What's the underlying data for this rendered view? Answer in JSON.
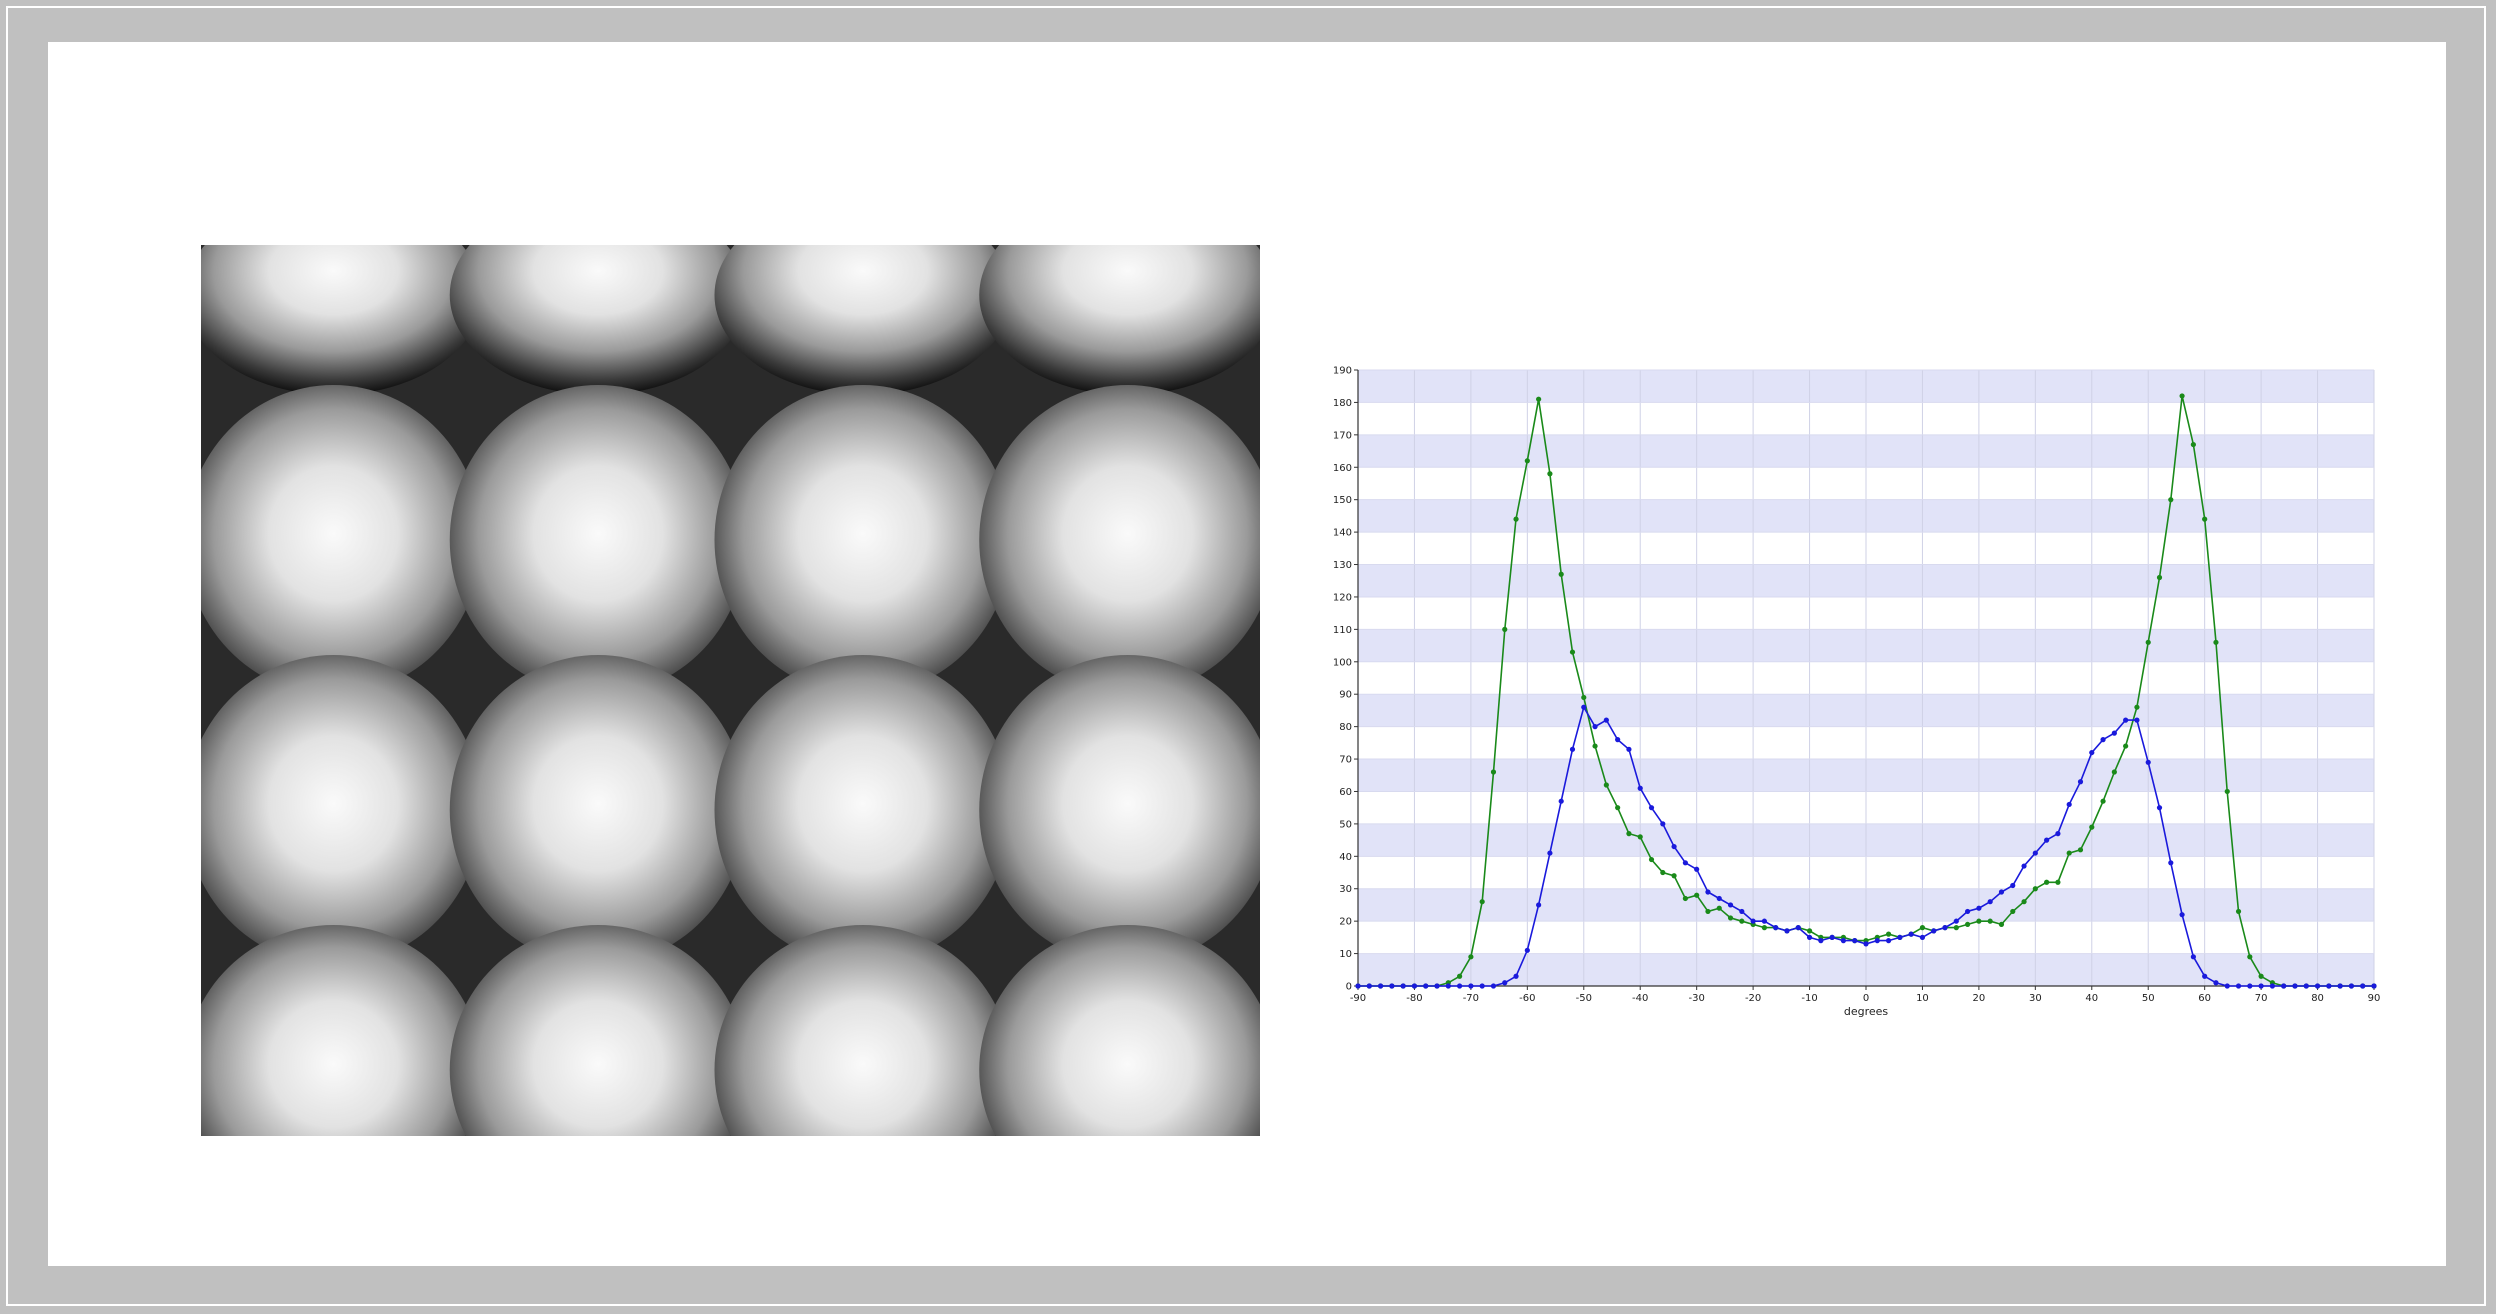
{
  "figure": {
    "image_alt_kind": "grayscale periodic intensity pattern"
  },
  "colors": {
    "background_border": "#c0c0c0",
    "canvas": "#ffffff",
    "band": "#e1e3f8",
    "series_green": "#1a8a1a",
    "series_blue": "#1a1adc",
    "axis": "#333333"
  },
  "chart_data": {
    "type": "line",
    "title": "",
    "xlabel": "degrees",
    "ylabel": "",
    "xlim": [
      -90,
      90
    ],
    "ylim": [
      0,
      190
    ],
    "x_ticks": [
      -90,
      -80,
      -70,
      -60,
      -50,
      -40,
      -30,
      -20,
      -10,
      0,
      10,
      20,
      30,
      40,
      50,
      60,
      70,
      80,
      90
    ],
    "y_ticks": [
      0,
      10,
      20,
      30,
      40,
      50,
      60,
      70,
      80,
      90,
      100,
      110,
      120,
      130,
      140,
      150,
      160,
      170,
      180,
      190
    ],
    "grid": "vertical lines and horizontal bands",
    "series": [
      {
        "color": "green",
        "points": [
          [
            -90,
            0
          ],
          [
            -88,
            0
          ],
          [
            -86,
            0
          ],
          [
            -84,
            0
          ],
          [
            -82,
            0
          ],
          [
            -80,
            0
          ],
          [
            -78,
            0
          ],
          [
            -76,
            0
          ],
          [
            -74,
            1
          ],
          [
            -72,
            3
          ],
          [
            -70,
            9
          ],
          [
            -68,
            26
          ],
          [
            -66,
            66
          ],
          [
            -64,
            110
          ],
          [
            -62,
            144
          ],
          [
            -60,
            162
          ],
          [
            -58,
            181
          ],
          [
            -56,
            158
          ],
          [
            -54,
            127
          ],
          [
            -52,
            103
          ],
          [
            -50,
            89
          ],
          [
            -48,
            74
          ],
          [
            -46,
            62
          ],
          [
            -44,
            55
          ],
          [
            -42,
            47
          ],
          [
            -40,
            46
          ],
          [
            -38,
            39
          ],
          [
            -36,
            35
          ],
          [
            -34,
            34
          ],
          [
            -32,
            27
          ],
          [
            -30,
            28
          ],
          [
            -28,
            23
          ],
          [
            -26,
            24
          ],
          [
            -24,
            21
          ],
          [
            -22,
            20
          ],
          [
            -20,
            19
          ],
          [
            -18,
            18
          ],
          [
            -16,
            18
          ],
          [
            -14,
            17
          ],
          [
            -12,
            18
          ],
          [
            -10,
            17
          ],
          [
            -8,
            15
          ],
          [
            -6,
            15
          ],
          [
            -4,
            15
          ],
          [
            -2,
            14
          ],
          [
            0,
            14
          ],
          [
            2,
            15
          ],
          [
            4,
            16
          ],
          [
            6,
            15
          ],
          [
            8,
            16
          ],
          [
            10,
            18
          ],
          [
            12,
            17
          ],
          [
            14,
            18
          ],
          [
            16,
            18
          ],
          [
            18,
            19
          ],
          [
            20,
            20
          ],
          [
            22,
            20
          ],
          [
            24,
            19
          ],
          [
            26,
            23
          ],
          [
            28,
            26
          ],
          [
            30,
            30
          ],
          [
            32,
            32
          ],
          [
            34,
            32
          ],
          [
            36,
            41
          ],
          [
            38,
            42
          ],
          [
            40,
            49
          ],
          [
            42,
            57
          ],
          [
            44,
            66
          ],
          [
            46,
            74
          ],
          [
            48,
            86
          ],
          [
            50,
            106
          ],
          [
            52,
            126
          ],
          [
            54,
            150
          ],
          [
            56,
            182
          ],
          [
            58,
            167
          ],
          [
            60,
            144
          ],
          [
            62,
            106
          ],
          [
            64,
            60
          ],
          [
            66,
            23
          ],
          [
            68,
            9
          ],
          [
            70,
            3
          ],
          [
            72,
            1
          ],
          [
            74,
            0
          ],
          [
            76,
            0
          ],
          [
            78,
            0
          ],
          [
            80,
            0
          ],
          [
            82,
            0
          ],
          [
            84,
            0
          ],
          [
            86,
            0
          ],
          [
            88,
            0
          ],
          [
            90,
            0
          ]
        ]
      },
      {
        "color": "blue",
        "points": [
          [
            -90,
            0
          ],
          [
            -88,
            0
          ],
          [
            -86,
            0
          ],
          [
            -84,
            0
          ],
          [
            -82,
            0
          ],
          [
            -80,
            0
          ],
          [
            -78,
            0
          ],
          [
            -76,
            0
          ],
          [
            -74,
            0
          ],
          [
            -72,
            0
          ],
          [
            -70,
            0
          ],
          [
            -68,
            0
          ],
          [
            -66,
            0
          ],
          [
            -64,
            1
          ],
          [
            -62,
            3
          ],
          [
            -60,
            11
          ],
          [
            -58,
            25
          ],
          [
            -56,
            41
          ],
          [
            -54,
            57
          ],
          [
            -52,
            73
          ],
          [
            -50,
            86
          ],
          [
            -48,
            80
          ],
          [
            -46,
            82
          ],
          [
            -44,
            76
          ],
          [
            -42,
            73
          ],
          [
            -40,
            61
          ],
          [
            -38,
            55
          ],
          [
            -36,
            50
          ],
          [
            -34,
            43
          ],
          [
            -32,
            38
          ],
          [
            -30,
            36
          ],
          [
            -28,
            29
          ],
          [
            -26,
            27
          ],
          [
            -24,
            25
          ],
          [
            -22,
            23
          ],
          [
            -20,
            20
          ],
          [
            -18,
            20
          ],
          [
            -16,
            18
          ],
          [
            -14,
            17
          ],
          [
            -12,
            18
          ],
          [
            -10,
            15
          ],
          [
            -8,
            14
          ],
          [
            -6,
            15
          ],
          [
            -4,
            14
          ],
          [
            -2,
            14
          ],
          [
            0,
            13
          ],
          [
            2,
            14
          ],
          [
            4,
            14
          ],
          [
            6,
            15
          ],
          [
            8,
            16
          ],
          [
            10,
            15
          ],
          [
            12,
            17
          ],
          [
            14,
            18
          ],
          [
            16,
            20
          ],
          [
            18,
            23
          ],
          [
            20,
            24
          ],
          [
            22,
            26
          ],
          [
            24,
            29
          ],
          [
            26,
            31
          ],
          [
            28,
            37
          ],
          [
            30,
            41
          ],
          [
            32,
            45
          ],
          [
            34,
            47
          ],
          [
            36,
            56
          ],
          [
            38,
            63
          ],
          [
            40,
            72
          ],
          [
            42,
            76
          ],
          [
            44,
            78
          ],
          [
            46,
            82
          ],
          [
            48,
            82
          ],
          [
            50,
            69
          ],
          [
            52,
            55
          ],
          [
            54,
            38
          ],
          [
            56,
            22
          ],
          [
            58,
            9
          ],
          [
            60,
            3
          ],
          [
            62,
            1
          ],
          [
            64,
            0
          ],
          [
            66,
            0
          ],
          [
            68,
            0
          ],
          [
            70,
            0
          ],
          [
            72,
            0
          ],
          [
            74,
            0
          ],
          [
            76,
            0
          ],
          [
            78,
            0
          ],
          [
            80,
            0
          ],
          [
            82,
            0
          ],
          [
            84,
            0
          ],
          [
            86,
            0
          ],
          [
            88,
            0
          ],
          [
            90,
            0
          ]
        ]
      }
    ]
  }
}
